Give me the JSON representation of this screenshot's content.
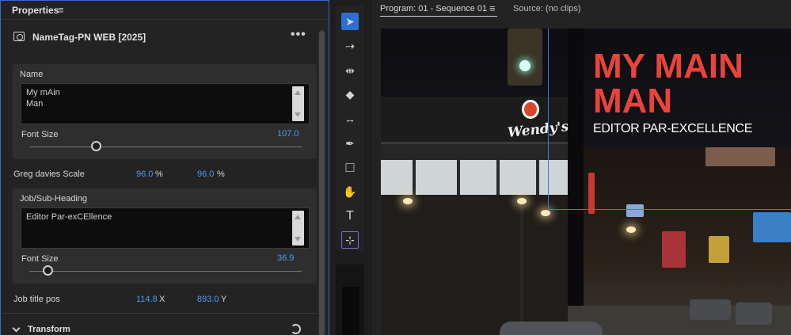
{
  "properties": {
    "panel_title": "Properties",
    "menu_glyph": "≡",
    "clip_name": "NameTag-PN WEB [2025]",
    "more_glyph": "•••",
    "name_group": {
      "label": "Name",
      "text_value": "My mAin\nMan",
      "font_size_label": "Font Size",
      "font_size_value": "107.0"
    },
    "scale_row": {
      "label": "Greg davies Scale",
      "x_value": "96.0",
      "x_unit": "%",
      "y_value": "96.0",
      "y_unit": "%"
    },
    "job_group": {
      "label": "Job/Sub-Heading",
      "text_value": "Editor Par-exCEllence",
      "font_size_label": "Font Size",
      "font_size_value": "36.9"
    },
    "pos_row": {
      "label": "Job title pos",
      "x_value": "114.8",
      "x_unit": "X",
      "y_value": "893.0",
      "y_unit": "Y"
    },
    "transform_label": "Transform"
  },
  "tools": {
    "items": [
      "selection-tool",
      "track-select-tool",
      "ripple-edit-tool",
      "razor-tool",
      "slip-tool",
      "pen-tool",
      "rectangle-tool",
      "hand-tool",
      "type-tool",
      "vertical-type-tool"
    ],
    "glyphs": {
      "selection": "➤",
      "track_select": "⇢",
      "ripple": "⇹",
      "razor": "◆",
      "slip": "↔",
      "pen": "✒",
      "rect": "□",
      "hand": "✋",
      "type": "T",
      "vtype": "⊹"
    }
  },
  "monitor": {
    "program_tab": "Program: 01 - Sequence 01",
    "menu_glyph": "≡",
    "source_tab": "Source: (no clips)",
    "title_main_line1": "MY MAIN",
    "title_main_line2": "MAN",
    "title_sub": "EDITOR PAR-EXCELLENCE",
    "sign_text": "Wendy's"
  },
  "colors": {
    "accent": "#2c6fd1",
    "value_blue": "#4b9cf0",
    "title_red": "#e8443b"
  }
}
